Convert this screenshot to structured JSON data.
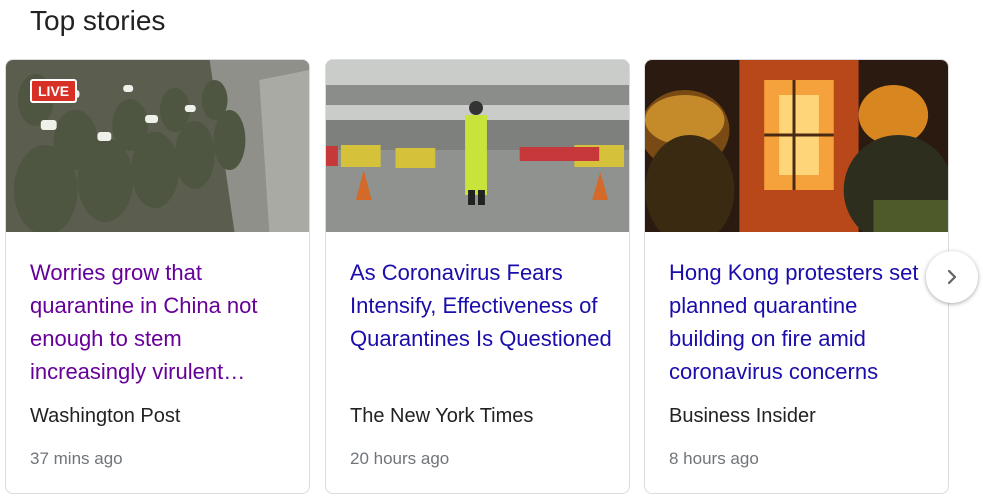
{
  "section": {
    "title": "Top stories"
  },
  "cards": [
    {
      "badge": "LIVE",
      "headline": "Worries grow that quarantine in China not enough to stem increasingly virulent…",
      "source": "Washington Post",
      "time": "37 mins ago",
      "visited": true,
      "image": "soldiers-in-masks-marching"
    },
    {
      "headline": "As Coronavirus Fears Intensify, Effectiveness of Quarantines Is Questioned",
      "source": "The New York Times",
      "time": "20 hours ago",
      "visited": false,
      "image": "police-officer-at-checkpoint"
    },
    {
      "headline": "Hong Kong protesters set planned quarantine building on fire amid coronavirus concerns",
      "source": "Business Insider",
      "time": "8 hours ago",
      "visited": false,
      "image": "firefighters-at-burning-building"
    }
  ],
  "next_button": {
    "icon": "chevron-right-icon"
  },
  "colors": {
    "visited_link": "#660099",
    "link": "#1a0dab",
    "live_badge": "#d93025",
    "meta_text": "#70757a"
  }
}
